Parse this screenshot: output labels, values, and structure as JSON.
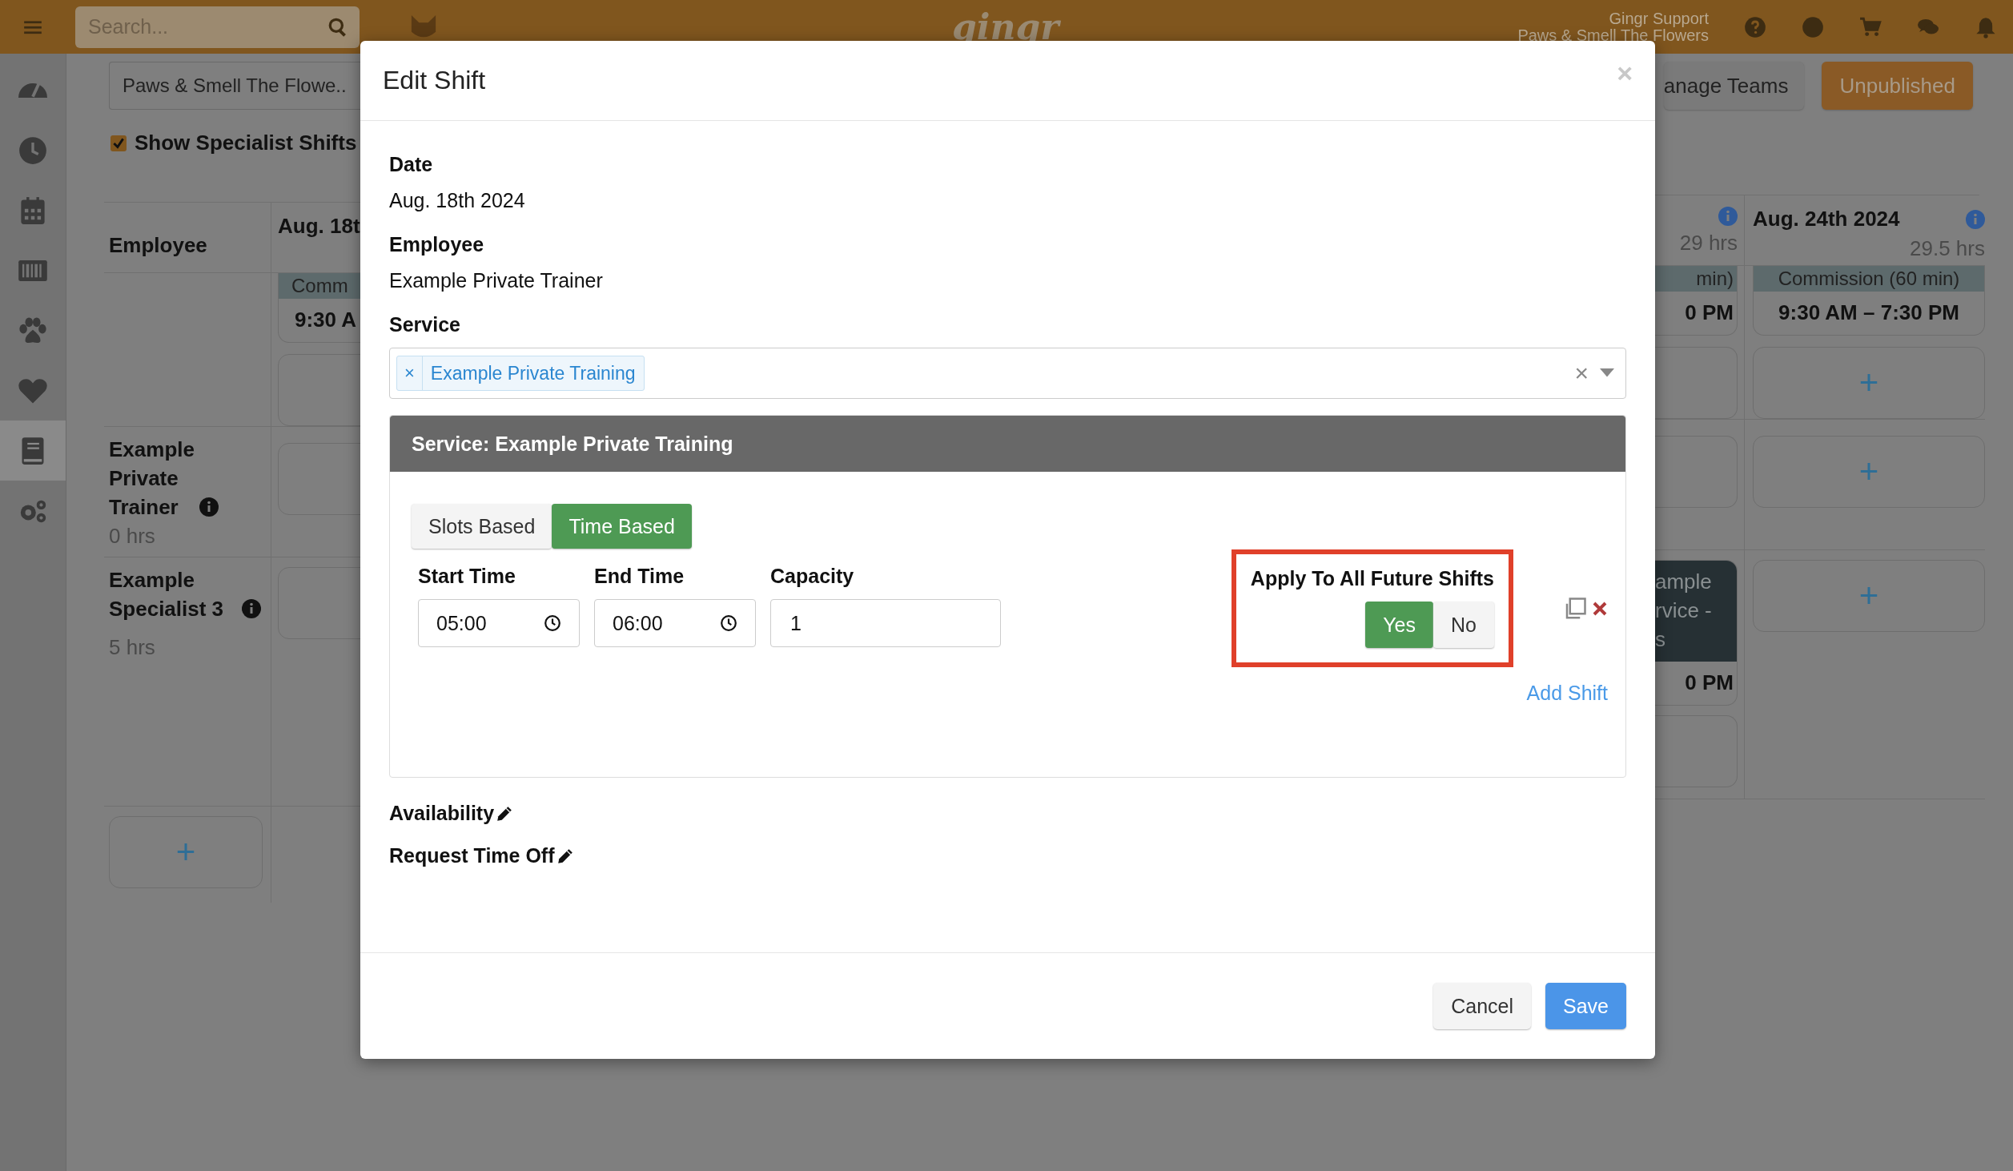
{
  "top_bar": {
    "search": {
      "placeholder": "Search..."
    },
    "logo": "gingr",
    "user": {
      "name": "Gingr Support",
      "location": "Paws & Smell The Flowers"
    },
    "icons": [
      {
        "kind": "help"
      },
      {
        "kind": "avatar"
      },
      {
        "kind": "cart"
      },
      {
        "kind": "chat"
      },
      {
        "kind": "bell"
      }
    ]
  },
  "sidebar": {
    "items": [
      {
        "kind": "gauge",
        "selected": false
      },
      {
        "kind": "clock",
        "selected": false
      },
      {
        "kind": "calendar",
        "selected": false
      },
      {
        "kind": "barcode",
        "selected": false
      },
      {
        "kind": "paw",
        "selected": false
      },
      {
        "kind": "heart",
        "selected": false
      },
      {
        "kind": "book",
        "selected": true
      },
      {
        "kind": "gears",
        "selected": false
      }
    ]
  },
  "toolbar": {
    "location": "Paws & Smell The Flowe..",
    "show_specialist_shifts": {
      "label": "Show Specialist Shifts",
      "checked": true
    },
    "buttons": [
      {
        "label": "anage Teams",
        "kind": "default"
      },
      {
        "label": "Unpublished",
        "kind": "status"
      }
    ]
  },
  "schedule": {
    "employee_header": "Employee",
    "employees": [
      {
        "name": "Example Private Trainer",
        "hours": "0 hrs"
      },
      {
        "name": "Example Specialist 3",
        "hours": "5 hrs"
      }
    ],
    "add": "+",
    "left_day": {
      "date": "Aug. 18t",
      "shift_band": "Comm",
      "shift_time": "9:30 A"
    },
    "right_days": [
      {
        "hours": "29 hrs",
        "shift_band": "min)",
        "shift_time": "0 PM",
        "specialist_lines": [
          "ample",
          "rvice -",
          "s"
        ],
        "specialist_time": "0 PM"
      },
      {
        "date": "Aug. 24th 2024",
        "hours": "29.5 hrs",
        "shift_band": "Commission (60 min)",
        "shift_time": "9:30 AM – 7:30 PM",
        "adds": [
          "+",
          "+",
          "+"
        ]
      }
    ]
  },
  "dialog": {
    "title": "Edit Shift",
    "close": "×",
    "fields": [
      {
        "label": "Date",
        "value": "Aug. 18th 2024"
      },
      {
        "label": "Employee",
        "value": "Example Private Trainer"
      }
    ],
    "service": {
      "label": "Service",
      "tags": [
        {
          "remove": "×",
          "text": "Example Private Training"
        }
      ],
      "clear": "×"
    },
    "service_panel": {
      "title": "Service: Example Private Training",
      "modes": [
        {
          "label": "Slots Based",
          "selected": false
        },
        {
          "label": "Time Based",
          "selected": true
        }
      ],
      "inputs": [
        {
          "label": "Start Time",
          "value": "05:00",
          "kind": "time"
        },
        {
          "label": "End Time",
          "value": "06:00",
          "kind": "time"
        },
        {
          "label": "Capacity",
          "value": "1",
          "kind": "number"
        }
      ],
      "apply_future": {
        "label": "Apply To All Future Shifts",
        "options": [
          {
            "label": "Yes",
            "selected": true
          },
          {
            "label": "No",
            "selected": false
          }
        ]
      },
      "add_shift": "Add Shift"
    },
    "links": [
      "Availability",
      "Request Time Off"
    ],
    "buttons": [
      {
        "label": "Cancel",
        "kind": "default"
      },
      {
        "label": "Save",
        "kind": "primary"
      }
    ]
  }
}
